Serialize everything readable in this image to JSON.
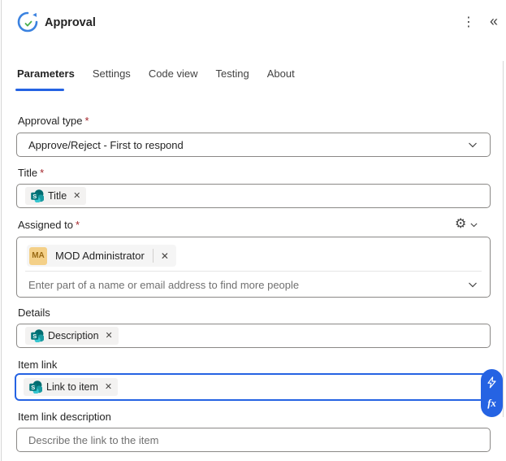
{
  "header": {
    "title": "Approval"
  },
  "icons": {
    "more": "⋮",
    "collapse": "«",
    "gear": "⚙",
    "dismiss": "✕"
  },
  "required_marker": "*",
  "tabs": [
    {
      "label": "Parameters",
      "active": true
    },
    {
      "label": "Settings",
      "active": false
    },
    {
      "label": "Code view",
      "active": false
    },
    {
      "label": "Testing",
      "active": false
    },
    {
      "label": "About",
      "active": false
    }
  ],
  "fields": {
    "approval_type": {
      "label": "Approval type",
      "required": true,
      "value": "Approve/Reject - First to respond"
    },
    "title": {
      "label": "Title",
      "required": true,
      "token": "Title"
    },
    "assigned_to": {
      "label": "Assigned to",
      "required": true,
      "person": {
        "initials": "MA",
        "name": "MOD Administrator"
      },
      "placeholder": "Enter part of a name or email address to find more people"
    },
    "details": {
      "label": "Details",
      "token": "Description"
    },
    "item_link": {
      "label": "Item link",
      "token": "Link to item"
    },
    "item_link_description": {
      "label": "Item link description",
      "placeholder": "Describe the link to the item"
    }
  },
  "floating_actions": {
    "fx_label": "fx"
  },
  "colors": {
    "accent_blue": "#2563e3",
    "required_red": "#a4262c",
    "sharepoint_dark": "#036C70",
    "sharepoint_mid": "#1A9BA1",
    "sharepoint_light": "#37C6D0",
    "avatar_bg": "#f4d088",
    "avatar_text": "#9a6a14",
    "approval_icon_blue": "#3b82e0",
    "approval_icon_green": "#4caf50"
  }
}
